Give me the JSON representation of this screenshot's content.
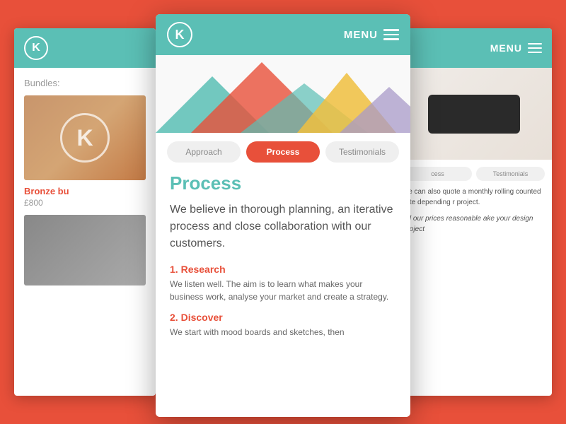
{
  "colors": {
    "teal": "#5bbfb5",
    "red": "#e8503a",
    "bg": "#e8503a",
    "white": "#ffffff",
    "gray_light": "#efefef",
    "gray_text": "#888888",
    "body_text": "#555555"
  },
  "left_card": {
    "logo": "K",
    "bundles_label": "Bundles:",
    "bundle_logo": "K",
    "bundle_name": "Bronze bu",
    "price": "£800"
  },
  "right_card": {
    "menu_label": "MENU",
    "tabs": [
      "cess",
      "Testimonials"
    ]
  },
  "main_card": {
    "logo": "K",
    "menu_label": "MENU",
    "tabs": [
      {
        "label": "Approach",
        "state": "inactive"
      },
      {
        "label": "Process",
        "state": "active"
      },
      {
        "label": "Testimonials",
        "state": "inactive"
      }
    ],
    "section_title": "Process",
    "intro": "We believe in thorough planning, an iterative process and close collaboration with our customers.",
    "items": [
      {
        "number": "1.",
        "heading": "Research",
        "text": "We listen well. The aim is to learn what makes your business work, analyse your market and create a strategy."
      },
      {
        "number": "2.",
        "heading": "Discover",
        "text": "We start with mood boards and sketches, then"
      }
    ]
  }
}
